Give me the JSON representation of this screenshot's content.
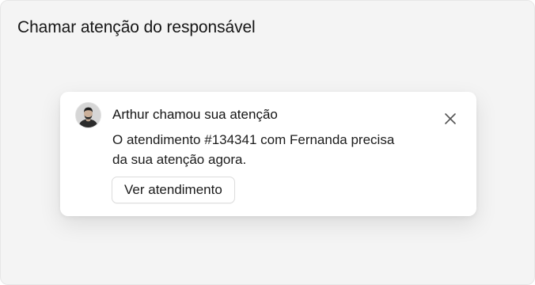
{
  "page": {
    "title": "Chamar atenção do responsável"
  },
  "notification": {
    "avatar_icon": "user-avatar-photo",
    "title": "Arthur chamou sua atenção",
    "message": "O atendimento #134341 com Fernanda precisa da sua atenção agora.",
    "action_label": "Ver atendimento",
    "close_icon": "close-icon"
  },
  "colors": {
    "background": "#f4f4f4",
    "card": "#ffffff",
    "text": "#1a1a1a",
    "button_border": "#dcdcdc",
    "icon": "#555555"
  }
}
